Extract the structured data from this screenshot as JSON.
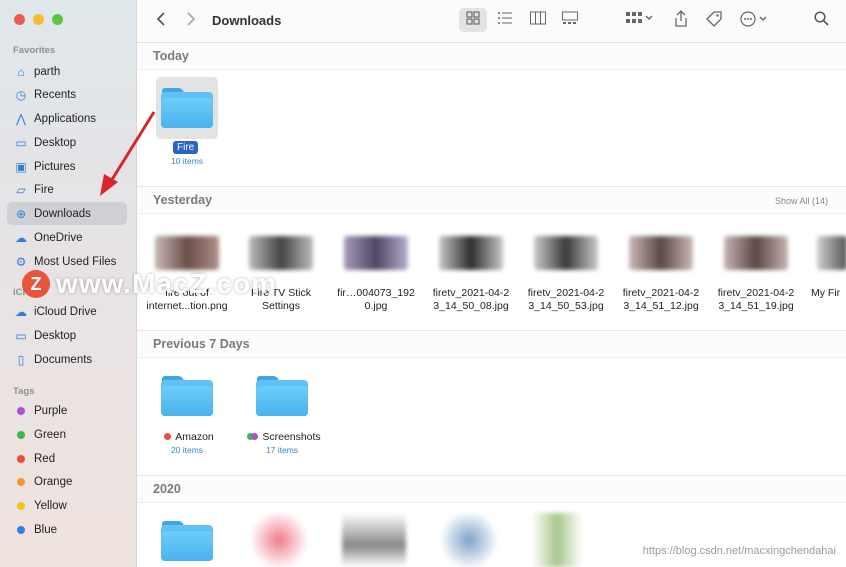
{
  "sidebar": {
    "sections": {
      "favorites": "Favorites",
      "icloud": "iCl",
      "tags": "Tags"
    },
    "favorites": [
      {
        "label": "parth",
        "icon": "home-icon"
      },
      {
        "label": "Recents",
        "icon": "clock-icon"
      },
      {
        "label": "Applications",
        "icon": "applications-icon"
      },
      {
        "label": "Desktop",
        "icon": "desktop-icon"
      },
      {
        "label": "Pictures",
        "icon": "pictures-icon"
      },
      {
        "label": "Fire",
        "icon": "folder-icon"
      },
      {
        "label": "Downloads",
        "icon": "downloads-icon",
        "selected": true
      },
      {
        "label": "OneDrive",
        "icon": "cloud-icon"
      },
      {
        "label": "Most Used Files",
        "icon": "gear-icon"
      }
    ],
    "icloud": [
      {
        "label": "iCloud Drive",
        "icon": "icloud-icon"
      },
      {
        "label": "Desktop",
        "icon": "desktop-icon"
      },
      {
        "label": "Documents",
        "icon": "document-icon"
      }
    ],
    "tags": [
      {
        "label": "Purple",
        "color": "#a950d6"
      },
      {
        "label": "Green",
        "color": "#3db64a"
      },
      {
        "label": "Red",
        "color": "#f04a3d"
      },
      {
        "label": "Orange",
        "color": "#f39a26"
      },
      {
        "label": "Yellow",
        "color": "#f2c418"
      },
      {
        "label": "Blue",
        "color": "#2d7ff0"
      }
    ]
  },
  "toolbar": {
    "title": "Downloads"
  },
  "groups": {
    "today": {
      "title": "Today",
      "items": [
        {
          "name": "Fire",
          "sub": "10 items"
        }
      ]
    },
    "yesterday": {
      "title": "Yesterday",
      "show_all": "Show All (14)",
      "items": [
        {
          "line1": "fire out of",
          "line2": "internet...tion.png"
        },
        {
          "line1": "Fire TV Stick",
          "line2": "Settings"
        },
        {
          "line1": "fir…004073_192",
          "line2": "0.jpg"
        },
        {
          "line1": "firetv_2021-04-2",
          "line2": "3_14_50_08.jpg"
        },
        {
          "line1": "firetv_2021-04-2",
          "line2": "3_14_50_53.jpg"
        },
        {
          "line1": "firetv_2021-04-2",
          "line2": "3_14_51_12.jpg"
        },
        {
          "line1": "firetv_2021-04-2",
          "line2": "3_14_51_19.jpg"
        },
        {
          "line1": "My Fir",
          "line2": ""
        }
      ]
    },
    "previous": {
      "title": "Previous 7 Days",
      "items": [
        {
          "name": "Amazon",
          "sub": "20 items",
          "tag_colors": [
            "#f04a3d"
          ]
        },
        {
          "name": "Screenshots",
          "sub": "17 items",
          "tag_colors": [
            "#3db64a",
            "#a950d6"
          ]
        }
      ]
    },
    "y2020": {
      "title": "2020"
    }
  },
  "watermark": {
    "logo": "Z",
    "text": "www.MacZ.com"
  },
  "source_url": "https://blog.csdn.net/macxingchendahai"
}
